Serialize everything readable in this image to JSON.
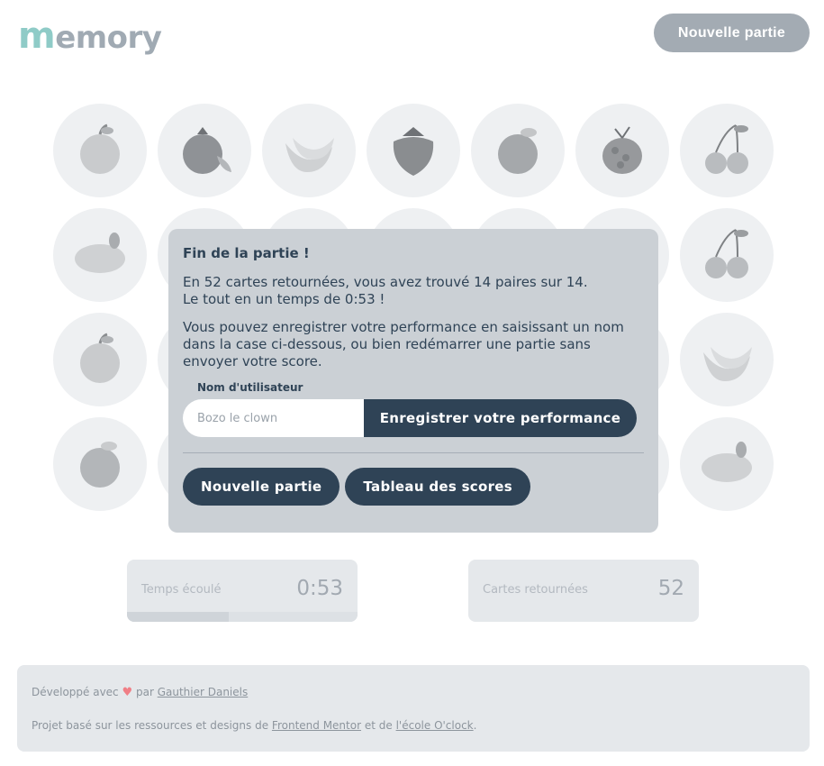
{
  "header": {
    "logo_first": "m",
    "logo_rest": "emory",
    "new_game_label": "Nouvelle partie"
  },
  "cards": [
    "apple-icon",
    "pomegranate-icon",
    "banana-icon",
    "strawberry-icon",
    "peach-icon",
    "raspberry-icon",
    "cherry-icon",
    "lemon-icon",
    "",
    "",
    "",
    "",
    "",
    "cherry-icon",
    "apple-icon",
    "",
    "",
    "",
    "",
    "",
    "banana-icon",
    "orange-icon",
    "",
    "",
    "",
    "",
    "",
    "lemon-icon"
  ],
  "modal": {
    "title": "Fin de la partie !",
    "result_line1": "En 52 cartes retournées, vous avez trouvé 14 paires sur 14.",
    "result_line2": "Le tout en un temps de 0:53 !",
    "explanation": "Vous pouvez enregistrer votre performance en saisissant un nom dans la case ci-dessous, ou bien redémarrer une partie sans envoyer votre score.",
    "username_label": "Nom d'utilisateur",
    "username_placeholder": "Bozo le clown",
    "username_value": "",
    "save_label": "Enregistrer votre performance",
    "new_game_label": "Nouvelle partie",
    "scores_label": "Tableau des scores"
  },
  "stats": {
    "time_label": "Temps écoulé",
    "time_value": "0:53",
    "time_progress": 0.44,
    "cards_label": "Cartes retournées",
    "cards_value": "52"
  },
  "footer": {
    "dev_prefix": "Développé avec",
    "dev_by": "par",
    "dev_name": "Gauthier Daniels",
    "project_prefix": "Projet basé sur les ressources et designs de",
    "frontend_mentor": "Frontend Mentor",
    "and_of": "et de",
    "oclock": "l'école O'clock",
    "period": "."
  },
  "colors": {
    "accent_dark": "#2f4356",
    "logo_m": "#8fcbc7",
    "heart": "#f07f86"
  }
}
